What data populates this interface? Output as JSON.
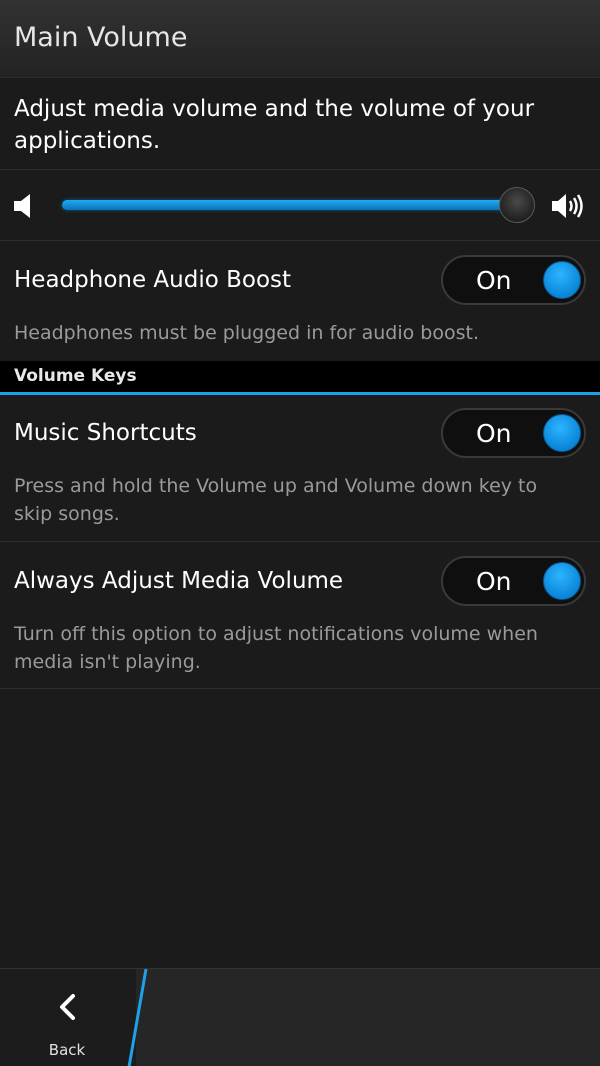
{
  "header": {
    "title": "Main Volume"
  },
  "description": "Adjust media volume and the volume of your applications.",
  "volume": {
    "level": 1.0,
    "min_icon": "speaker-low-icon",
    "max_icon": "speaker-high-icon",
    "accent": "#1da1e8"
  },
  "settings": [
    {
      "label": "Headphone Audio Boost",
      "state": "On",
      "note": "Headphones must be plugged in for audio boost."
    }
  ],
  "section": {
    "label": "Volume Keys"
  },
  "volume_keys_settings": [
    {
      "label": "Music Shortcuts",
      "state": "On",
      "note": "Press and hold the Volume up and Volume down key to skip songs."
    },
    {
      "label": "Always Adjust Media Volume",
      "state": "On",
      "note": "Turn off this option to adjust notifications volume when media isn't playing."
    }
  ],
  "action_bar": {
    "back_label": "Back",
    "back_icon": "chevron-left-icon"
  }
}
